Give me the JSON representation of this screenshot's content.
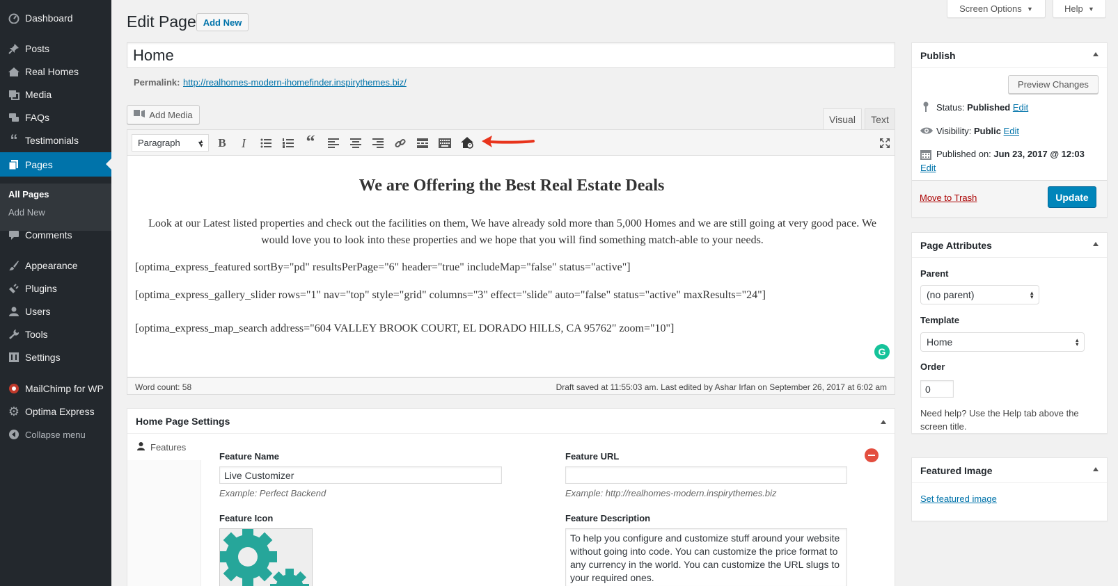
{
  "sidebar": {
    "items": [
      {
        "label": "Dashboard",
        "icon": "dashboard-icon"
      },
      {
        "label": "Posts",
        "icon": "pin-icon"
      },
      {
        "label": "Real Homes",
        "icon": "homes-icon"
      },
      {
        "label": "Media",
        "icon": "media-icon"
      },
      {
        "label": "FAQs",
        "icon": "comments-icon"
      },
      {
        "label": "Testimonials",
        "icon": "quote-icon"
      },
      {
        "label": "Pages",
        "icon": "pages-icon"
      },
      {
        "label": "Comments",
        "icon": "comment-icon"
      },
      {
        "label": "Appearance",
        "icon": "brush-icon"
      },
      {
        "label": "Plugins",
        "icon": "plug-icon"
      },
      {
        "label": "Users",
        "icon": "user-icon"
      },
      {
        "label": "Tools",
        "icon": "wrench-icon"
      },
      {
        "label": "Settings",
        "icon": "settings-icon"
      },
      {
        "label": "MailChimp for WP",
        "icon": "mailchimp-icon"
      },
      {
        "label": "Optima Express",
        "icon": "gear-icon"
      },
      {
        "label": "Collapse menu",
        "icon": "collapse-icon"
      }
    ],
    "submenu": {
      "all_pages": "All Pages",
      "add_new": "Add New"
    }
  },
  "top": {
    "screen_options": "Screen Options",
    "help": "Help"
  },
  "header": {
    "title": "Edit Page",
    "add_new": "Add New"
  },
  "post": {
    "title": "Home",
    "permalink_label": "Permalink:",
    "permalink_url": "http://realhomes-modern-ihomefinder.inspirythemes.biz/"
  },
  "editor": {
    "add_media": "Add Media",
    "tab_visual": "Visual",
    "tab_text": "Text",
    "format_select": "Paragraph",
    "heading": "We are Offering the Best Real Estate Deals",
    "intro": "Look at our Latest listed properties and check out the facilities on them, We have already sold more than 5,000 Homes and we are still going at very good pace. We would love you to look into these properties and we hope that you will find something match-able to your needs.",
    "shortcode1": "[optima_express_featured sortBy=\"pd\" resultsPerPage=\"6\" header=\"true\" includeMap=\"false\" status=\"active\"]",
    "shortcode2": "[optima_express_gallery_slider rows=\"1\" nav=\"top\" style=\"grid\" columns=\"3\" effect=\"slide\" auto=\"false\" status=\"active\" maxResults=\"24\"]",
    "shortcode3": "[optima_express_map_search address=\"604 VALLEY BROOK COURT, EL DORADO HILLS, CA 95762\" zoom=\"10\"]",
    "word_count": "Word count: 58",
    "draft_status": "Draft saved at 11:55:03 am. Last edited by Ashar Irfan on September 26, 2017 at 6:02 am"
  },
  "home_settings": {
    "title": "Home Page Settings",
    "tab": "Features",
    "feature_name_label": "Feature Name",
    "feature_name_value": "Live Customizer",
    "feature_name_hint": "Example: Perfect Backend",
    "feature_url_label": "Feature URL",
    "feature_url_value": "",
    "feature_url_hint": "Example: http://realhomes-modern.inspirythemes.biz",
    "feature_icon_label": "Feature Icon",
    "feature_desc_label": "Feature Description",
    "feature_desc_value": "To help you configure and customize stuff around your website without going into code. You can customize the price format to any currency in the world. You can customize the URL slugs to your required ones."
  },
  "publish": {
    "title": "Publish",
    "preview": "Preview Changes",
    "status_label": "Status:",
    "status_value": "Published",
    "visibility_label": "Visibility:",
    "visibility_value": "Public",
    "published_label": "Published on:",
    "published_value": "Jun 23, 2017 @ 12:03",
    "edit": "Edit",
    "trash": "Move to Trash",
    "update": "Update"
  },
  "attributes": {
    "title": "Page Attributes",
    "parent_label": "Parent",
    "parent_value": "(no parent)",
    "template_label": "Template",
    "template_value": "Home",
    "order_label": "Order",
    "order_value": "0",
    "help": "Need help? Use the Help tab above the screen title."
  },
  "featured_image": {
    "title": "Featured Image",
    "link": "Set featured image"
  },
  "colors": {
    "sidebar": "#23282d",
    "accent": "#0073aa",
    "trash": "#a00",
    "arrow": "#e8341c",
    "grammarly": "#15c39a",
    "remove": "#e34e3f",
    "gear": "#26a69a"
  }
}
